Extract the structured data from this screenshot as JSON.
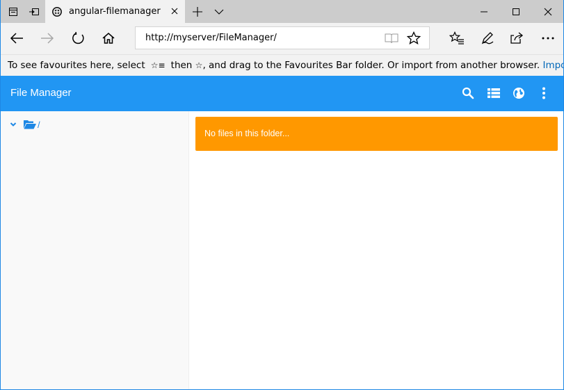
{
  "browser": {
    "tab": {
      "title": "angular-filemanager"
    },
    "address_bar": {
      "url": "http://myserver/FileManager/"
    },
    "favourites_bar": {
      "message_part1": "To see favourites here, select",
      "message_part2": "then",
      "message_part3": ", and drag to the Favourites Bar folder. Or import from another browser.",
      "import_link": "Import favourites"
    }
  },
  "app": {
    "title": "File Manager",
    "toolbar_icons": [
      "search-icon",
      "list-view-icon",
      "language-globe-icon",
      "more-vertical-icon"
    ],
    "tree": {
      "root_label": "/",
      "expanded": true
    },
    "empty_message": "No files in this folder...",
    "colors": {
      "header": "#2196f3",
      "alert": "#ff9800",
      "link": "#1e88e5"
    }
  }
}
